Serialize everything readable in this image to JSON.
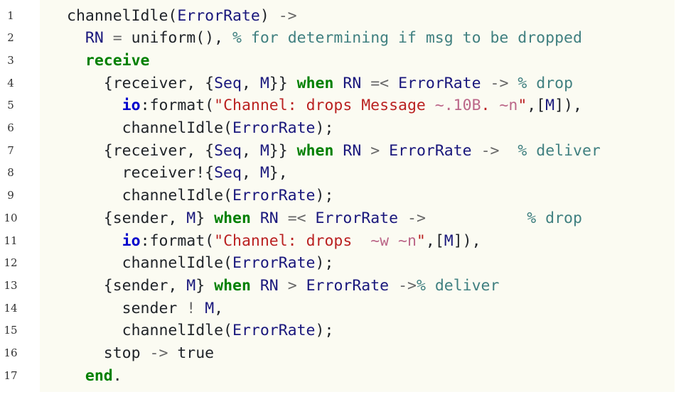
{
  "line_numbers": [
    "1",
    "2",
    "3",
    "4",
    "5",
    "6",
    "7",
    "8",
    "9",
    "10",
    "11",
    "12",
    "13",
    "14",
    "15",
    "16",
    "17"
  ],
  "lines": [
    [
      {
        "t": "channelIdle(",
        "c": "pl"
      },
      {
        "t": "ErrorRate",
        "c": "var"
      },
      {
        "t": ") ",
        "c": "pl"
      },
      {
        "t": "->",
        "c": "op"
      }
    ],
    [
      {
        "t": "  ",
        "c": "pl"
      },
      {
        "t": "RN",
        "c": "var"
      },
      {
        "t": " ",
        "c": "pl"
      },
      {
        "t": "=",
        "c": "op"
      },
      {
        "t": " uniform(), ",
        "c": "pl"
      },
      {
        "t": "% for determining if msg to be dropped",
        "c": "cm"
      }
    ],
    [
      {
        "t": "  ",
        "c": "pl"
      },
      {
        "t": "receive",
        "c": "kw"
      }
    ],
    [
      {
        "t": "    {receiver, {",
        "c": "pl"
      },
      {
        "t": "Seq",
        "c": "var"
      },
      {
        "t": ", ",
        "c": "pl"
      },
      {
        "t": "M",
        "c": "var"
      },
      {
        "t": "}} ",
        "c": "pl"
      },
      {
        "t": "when",
        "c": "kw"
      },
      {
        "t": " ",
        "c": "pl"
      },
      {
        "t": "RN",
        "c": "var"
      },
      {
        "t": " ",
        "c": "pl"
      },
      {
        "t": "=<",
        "c": "op"
      },
      {
        "t": " ",
        "c": "pl"
      },
      {
        "t": "ErrorRate",
        "c": "var"
      },
      {
        "t": " ",
        "c": "pl"
      },
      {
        "t": "->",
        "c": "op"
      },
      {
        "t": " ",
        "c": "pl"
      },
      {
        "t": "% drop",
        "c": "cm"
      }
    ],
    [
      {
        "t": "      ",
        "c": "pl"
      },
      {
        "t": "io",
        "c": "mod"
      },
      {
        "t": ":format(",
        "c": "pl"
      },
      {
        "t": "\"Channel: drops Message ",
        "c": "str"
      },
      {
        "t": "~.10B",
        "c": "esc"
      },
      {
        "t": ". ",
        "c": "str"
      },
      {
        "t": "~n",
        "c": "esc"
      },
      {
        "t": "\"",
        "c": "str"
      },
      {
        "t": ",[",
        "c": "pl"
      },
      {
        "t": "M",
        "c": "var"
      },
      {
        "t": "]),",
        "c": "pl"
      }
    ],
    [
      {
        "t": "      channelIdle(",
        "c": "pl"
      },
      {
        "t": "ErrorRate",
        "c": "var"
      },
      {
        "t": ");",
        "c": "pl"
      }
    ],
    [
      {
        "t": "    {receiver, {",
        "c": "pl"
      },
      {
        "t": "Seq",
        "c": "var"
      },
      {
        "t": ", ",
        "c": "pl"
      },
      {
        "t": "M",
        "c": "var"
      },
      {
        "t": "}} ",
        "c": "pl"
      },
      {
        "t": "when",
        "c": "kw"
      },
      {
        "t": " ",
        "c": "pl"
      },
      {
        "t": "RN",
        "c": "var"
      },
      {
        "t": " ",
        "c": "pl"
      },
      {
        "t": ">",
        "c": "op"
      },
      {
        "t": " ",
        "c": "pl"
      },
      {
        "t": "ErrorRate",
        "c": "var"
      },
      {
        "t": " ",
        "c": "pl"
      },
      {
        "t": "->",
        "c": "op"
      },
      {
        "t": "  ",
        "c": "pl"
      },
      {
        "t": "% deliver",
        "c": "cm"
      }
    ],
    [
      {
        "t": "      receiver!{",
        "c": "pl"
      },
      {
        "t": "Seq",
        "c": "var"
      },
      {
        "t": ", ",
        "c": "pl"
      },
      {
        "t": "M",
        "c": "var"
      },
      {
        "t": "},",
        "c": "pl"
      }
    ],
    [
      {
        "t": "      channelIdle(",
        "c": "pl"
      },
      {
        "t": "ErrorRate",
        "c": "var"
      },
      {
        "t": ");",
        "c": "pl"
      }
    ],
    [
      {
        "t": "    {sender, ",
        "c": "pl"
      },
      {
        "t": "M",
        "c": "var"
      },
      {
        "t": "} ",
        "c": "pl"
      },
      {
        "t": "when",
        "c": "kw"
      },
      {
        "t": " ",
        "c": "pl"
      },
      {
        "t": "RN",
        "c": "var"
      },
      {
        "t": " ",
        "c": "pl"
      },
      {
        "t": "=<",
        "c": "op"
      },
      {
        "t": " ",
        "c": "pl"
      },
      {
        "t": "ErrorRate",
        "c": "var"
      },
      {
        "t": " ",
        "c": "pl"
      },
      {
        "t": "->",
        "c": "op"
      },
      {
        "t": "           ",
        "c": "pl"
      },
      {
        "t": "% drop",
        "c": "cm"
      }
    ],
    [
      {
        "t": "      ",
        "c": "pl"
      },
      {
        "t": "io",
        "c": "mod"
      },
      {
        "t": ":format(",
        "c": "pl"
      },
      {
        "t": "\"Channel: drops  ",
        "c": "str"
      },
      {
        "t": "~w",
        "c": "esc"
      },
      {
        "t": " ",
        "c": "str"
      },
      {
        "t": "~n",
        "c": "esc"
      },
      {
        "t": "\"",
        "c": "str"
      },
      {
        "t": ",[",
        "c": "pl"
      },
      {
        "t": "M",
        "c": "var"
      },
      {
        "t": "]),",
        "c": "pl"
      }
    ],
    [
      {
        "t": "      channelIdle(",
        "c": "pl"
      },
      {
        "t": "ErrorRate",
        "c": "var"
      },
      {
        "t": ");",
        "c": "pl"
      }
    ],
    [
      {
        "t": "    {sender, ",
        "c": "pl"
      },
      {
        "t": "M",
        "c": "var"
      },
      {
        "t": "} ",
        "c": "pl"
      },
      {
        "t": "when",
        "c": "kw"
      },
      {
        "t": " ",
        "c": "pl"
      },
      {
        "t": "RN",
        "c": "var"
      },
      {
        "t": " ",
        "c": "pl"
      },
      {
        "t": ">",
        "c": "op"
      },
      {
        "t": " ",
        "c": "pl"
      },
      {
        "t": "ErrorRate",
        "c": "var"
      },
      {
        "t": " ",
        "c": "pl"
      },
      {
        "t": "->",
        "c": "op"
      },
      {
        "t": "% deliver",
        "c": "cm"
      }
    ],
    [
      {
        "t": "      sender ",
        "c": "pl"
      },
      {
        "t": "!",
        "c": "op"
      },
      {
        "t": " ",
        "c": "pl"
      },
      {
        "t": "M",
        "c": "var"
      },
      {
        "t": ",",
        "c": "pl"
      }
    ],
    [
      {
        "t": "      channelIdle(",
        "c": "pl"
      },
      {
        "t": "ErrorRate",
        "c": "var"
      },
      {
        "t": ");",
        "c": "pl"
      }
    ],
    [
      {
        "t": "    stop ",
        "c": "pl"
      },
      {
        "t": "->",
        "c": "op"
      },
      {
        "t": " true",
        "c": "pl"
      }
    ],
    [
      {
        "t": "  ",
        "c": "pl"
      },
      {
        "t": "end",
        "c": "kw"
      },
      {
        "t": ".",
        "c": "pl"
      }
    ]
  ]
}
